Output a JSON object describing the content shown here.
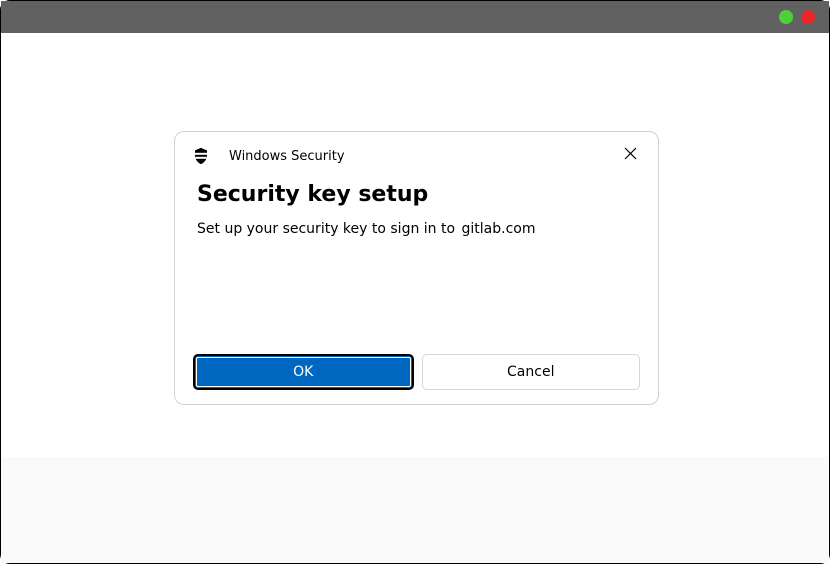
{
  "titlebar": {
    "dots": [
      "green",
      "red"
    ]
  },
  "dialog": {
    "app_title": "Windows Security",
    "heading": "Security key setup",
    "description_prefix": "Set up your security key to sign in to",
    "domain": "gitlab.com",
    "buttons": {
      "ok": "OK",
      "cancel": "Cancel"
    }
  },
  "icons": {
    "shield": "shield-icon",
    "close": "close-icon"
  },
  "colors": {
    "primary": "#0067C0",
    "titlebar": "#616161",
    "dot_green": "#4CD137",
    "dot_red": "#E9262A"
  }
}
